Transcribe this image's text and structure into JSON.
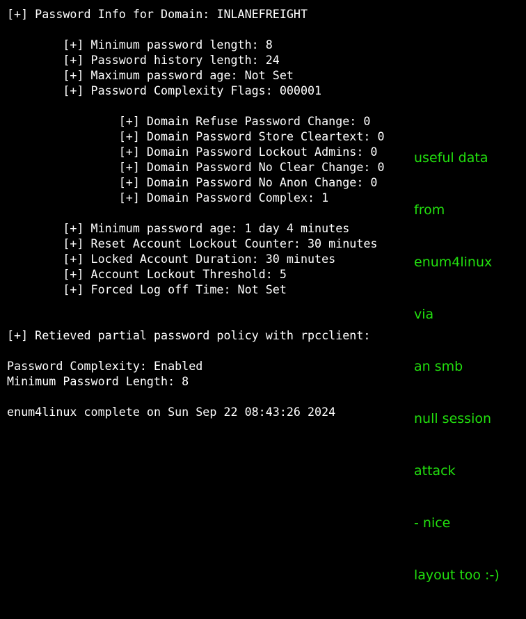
{
  "terminal": {
    "lines": [
      "[+] Password Info for Domain: INLANEFREIGHT",
      "",
      "        [+] Minimum password length: 8",
      "        [+] Password history length: 24",
      "        [+] Maximum password age: Not Set",
      "        [+] Password Complexity Flags: 000001",
      "",
      "                [+] Domain Refuse Password Change: 0",
      "                [+] Domain Password Store Cleartext: 0",
      "                [+] Domain Password Lockout Admins: 0",
      "                [+] Domain Password No Clear Change: 0",
      "                [+] Domain Password No Anon Change: 0",
      "                [+] Domain Password Complex: 1",
      "",
      "        [+] Minimum password age: 1 day 4 minutes",
      "        [+] Reset Account Lockout Counter: 30 minutes",
      "        [+] Locked Account Duration: 30 minutes",
      "        [+] Account Lockout Threshold: 5",
      "        [+] Forced Log off Time: Not Set",
      "",
      "",
      "[+] Retieved partial password policy with rpcclient:",
      "",
      "Password Complexity: Enabled",
      "Minimum Password Length: 8",
      "",
      "enum4linux complete on Sun Sep 22 08:43:26 2024"
    ]
  },
  "annotation": {
    "lines": [
      "useful data",
      "from",
      "enum4linux",
      "via",
      "an smb",
      "null session",
      "attack",
      "- nice",
      "layout too :-)"
    ],
    "color": "#22e00e"
  }
}
